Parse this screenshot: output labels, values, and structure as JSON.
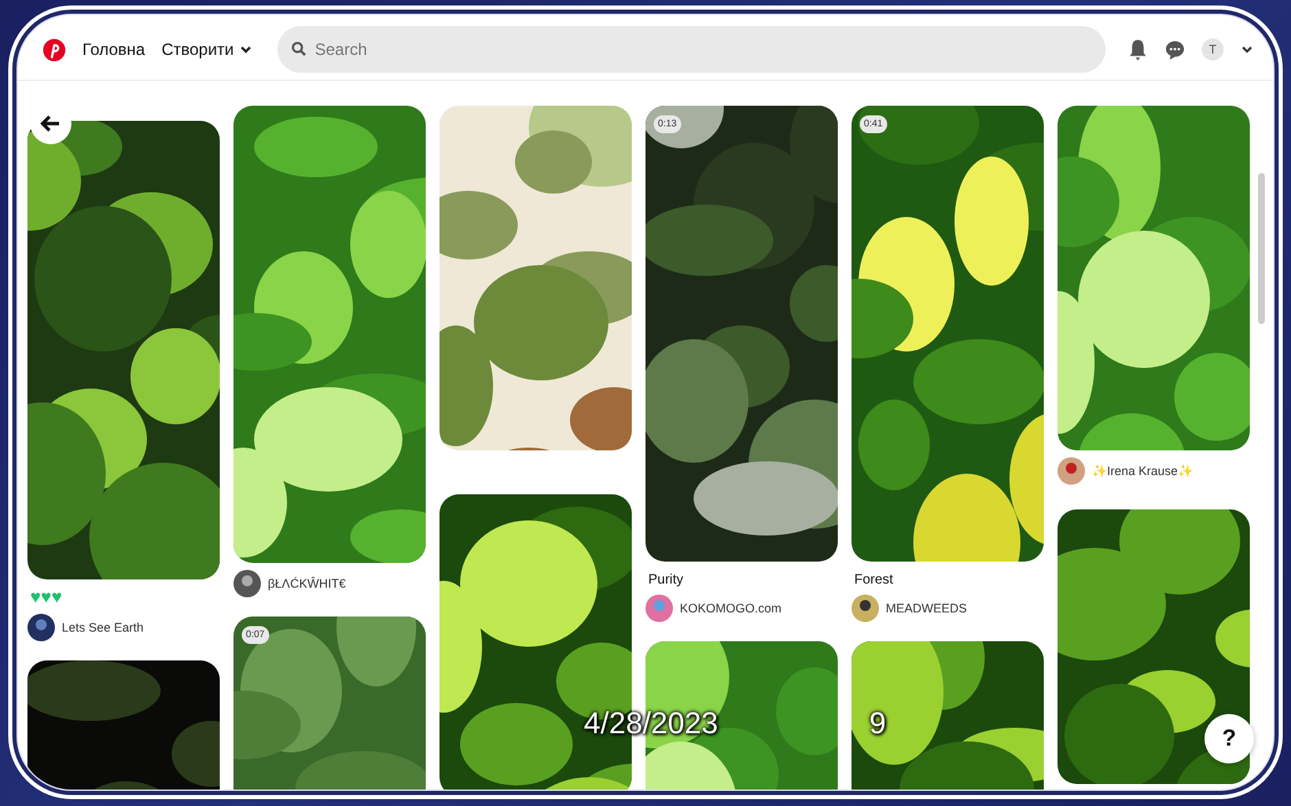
{
  "header": {
    "nav": [
      {
        "label": "Головна",
        "menu": false
      },
      {
        "label": "Створити",
        "menu": true
      }
    ],
    "search": {
      "placeholder": "Search"
    },
    "avatar": "T"
  },
  "columns": [
    [
      {
        "hearts": "♥♥♥",
        "author": "Lets See Earth"
      },
      {}
    ],
    [
      {
        "author": "βŁΛĆΚŴΗΙΤ€"
      },
      {
        "badge": "0:07"
      }
    ],
    [
      {},
      {}
    ],
    [
      {
        "badge": "0:13",
        "title": "Purity",
        "author": "KOKOMOGO.com"
      },
      {}
    ],
    [
      {
        "badge": "0:41",
        "title": "Forest",
        "author": "MEADWEEDS"
      },
      {}
    ],
    [
      {
        "author": "✨Irena Krause✨"
      },
      {}
    ]
  ],
  "help_button": "?",
  "slide": {
    "date": "4/28/2023",
    "page": "9"
  }
}
